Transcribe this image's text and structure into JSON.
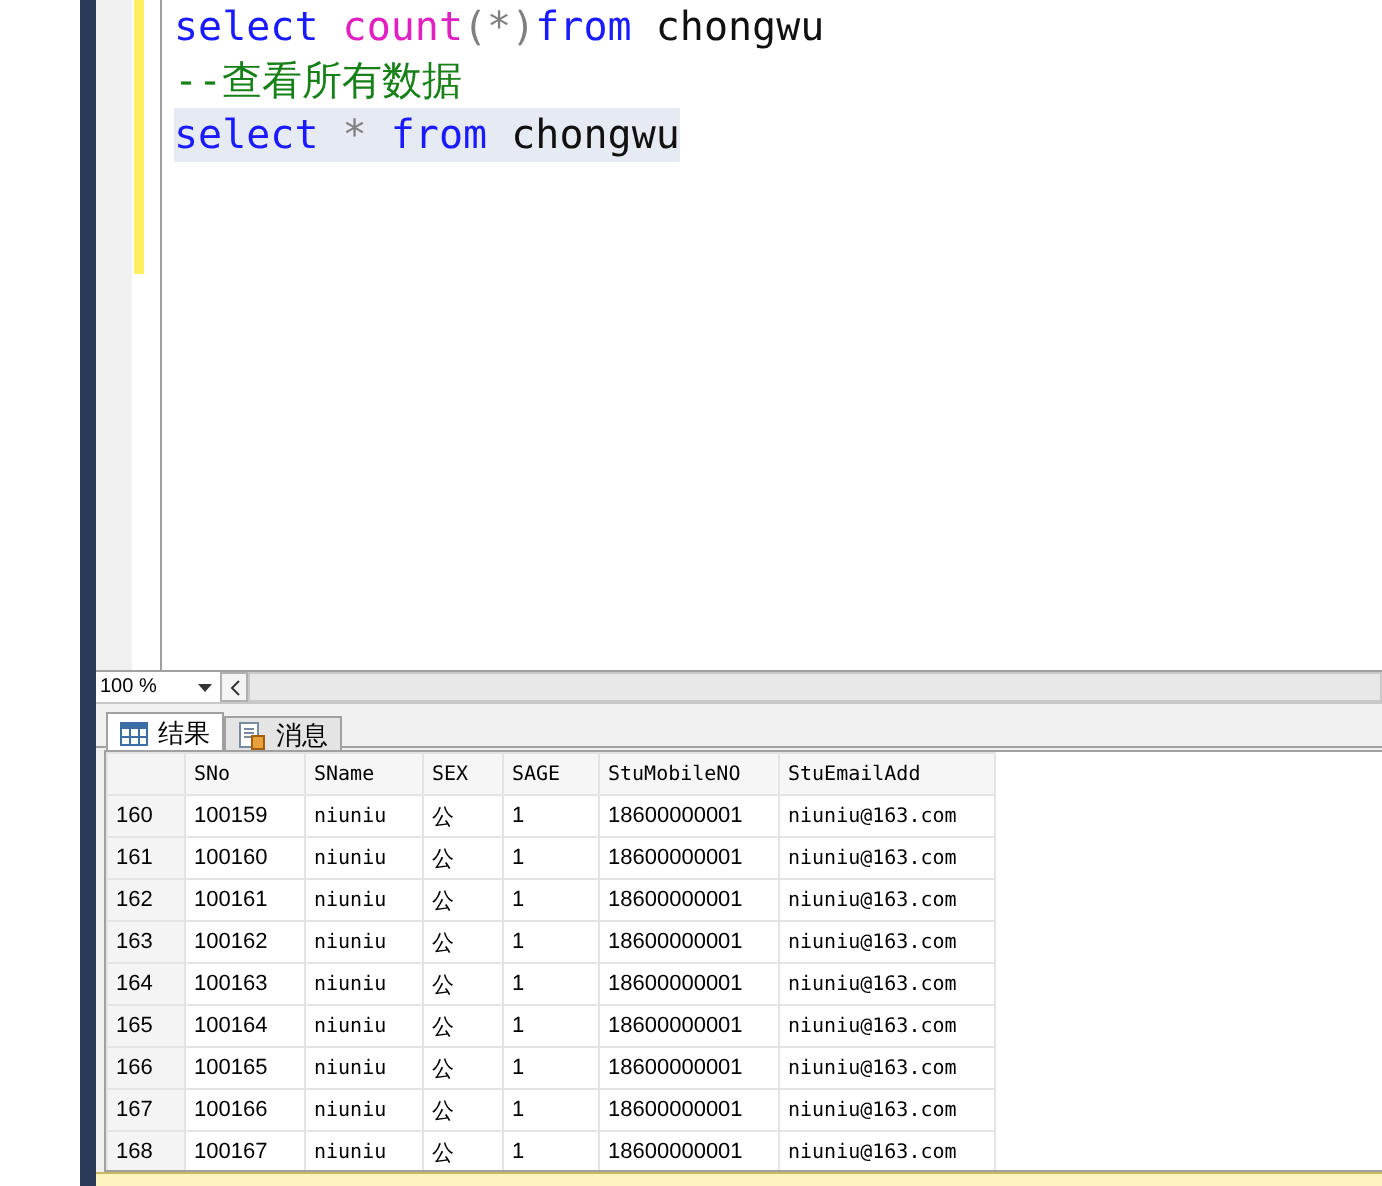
{
  "editor": {
    "lines": [
      {
        "highlighted": false,
        "tokens": [
          {
            "text": "select ",
            "kind": "keyword"
          },
          {
            "text": "count",
            "kind": "function"
          },
          {
            "text": "(*)",
            "kind": "operator"
          },
          {
            "text": "from ",
            "kind": "keyword"
          },
          {
            "text": "chongwu",
            "kind": "identifier"
          }
        ]
      },
      {
        "highlighted": false,
        "tokens": [
          {
            "text": "--查看所有数据",
            "kind": "comment"
          }
        ]
      },
      {
        "highlighted": true,
        "tokens": [
          {
            "text": "select ",
            "kind": "keyword"
          },
          {
            "text": "* ",
            "kind": "operator"
          },
          {
            "text": "from ",
            "kind": "keyword"
          },
          {
            "text": "chongwu",
            "kind": "identifier"
          }
        ]
      }
    ]
  },
  "zoom": {
    "value": "100 %"
  },
  "result_tabs": [
    {
      "label": "结果",
      "selected": true
    },
    {
      "label": "消息",
      "selected": false
    }
  ],
  "grid": {
    "columns": [
      "SNo",
      "SName",
      "SEX",
      "SAGE",
      "StuMobileNO",
      "StuEmailAdd"
    ],
    "rows": [
      {
        "row_number": "160",
        "cells": [
          "100159",
          "niuniu",
          "公",
          "1",
          "18600000001",
          "niuniu@163.com"
        ]
      },
      {
        "row_number": "161",
        "cells": [
          "100160",
          "niuniu",
          "公",
          "1",
          "18600000001",
          "niuniu@163.com"
        ]
      },
      {
        "row_number": "162",
        "cells": [
          "100161",
          "niuniu",
          "公",
          "1",
          "18600000001",
          "niuniu@163.com"
        ]
      },
      {
        "row_number": "163",
        "cells": [
          "100162",
          "niuniu",
          "公",
          "1",
          "18600000001",
          "niuniu@163.com"
        ]
      },
      {
        "row_number": "164",
        "cells": [
          "100163",
          "niuniu",
          "公",
          "1",
          "18600000001",
          "niuniu@163.com"
        ]
      },
      {
        "row_number": "165",
        "cells": [
          "100164",
          "niuniu",
          "公",
          "1",
          "18600000001",
          "niuniu@163.com"
        ]
      },
      {
        "row_number": "166",
        "cells": [
          "100165",
          "niuniu",
          "公",
          "1",
          "18600000001",
          "niuniu@163.com"
        ]
      },
      {
        "row_number": "167",
        "cells": [
          "100166",
          "niuniu",
          "公",
          "1",
          "18600000001",
          "niuniu@163.com"
        ]
      },
      {
        "row_number": "168",
        "cells": [
          "100167",
          "niuniu",
          "公",
          "1",
          "18600000001",
          "niuniu@163.com"
        ]
      }
    ]
  }
}
